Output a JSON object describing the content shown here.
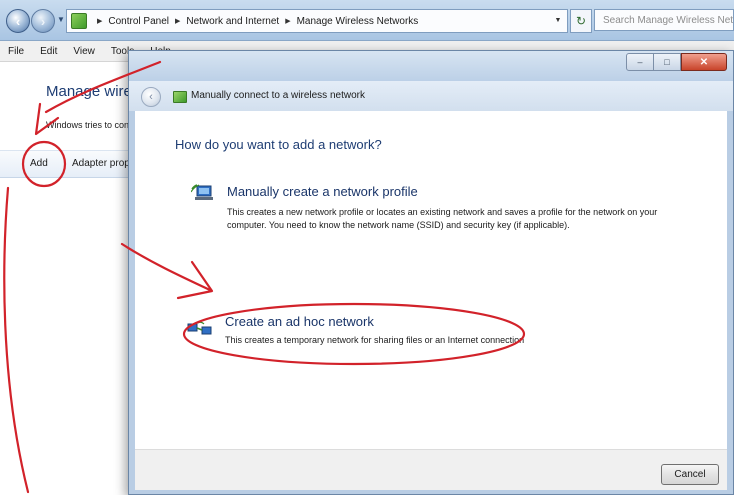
{
  "explorer": {
    "address_crumbs": [
      "Control Panel",
      "Network and Internet",
      "Manage Wireless Networks"
    ],
    "search_placeholder": "Search Manage Wireless Networks",
    "menu": [
      "File",
      "Edit",
      "View",
      "Tools",
      "Help"
    ],
    "page_title": "Manage wireless networks that use (Wireless Network Connection)",
    "page_desc": "Windows tries to connect to these networks in the order listed below.",
    "toolbar": {
      "add": "Add",
      "adapter": "Adapter properties"
    }
  },
  "dialog": {
    "title": "Manually connect to a wireless network",
    "question": "How do you want to add a network?",
    "options": [
      {
        "title": "Manually create a network profile",
        "desc": "This creates a new network profile or locates an existing network and saves a profile for the network on your computer. You need to know the network name (SSID) and security key (if applicable)."
      },
      {
        "title": "Create an ad hoc network",
        "desc": "This creates a temporary network for sharing files or an Internet connection"
      }
    ],
    "cancel_label": "Cancel"
  },
  "icons": [
    "back-icon",
    "forward-icon",
    "refresh-icon",
    "network-icon",
    "wireless-computer-icon",
    "adhoc-network-icon",
    "close-icon"
  ],
  "colors": {
    "annotation_red": "#d2222a",
    "heading_blue": "#1e3d73"
  }
}
